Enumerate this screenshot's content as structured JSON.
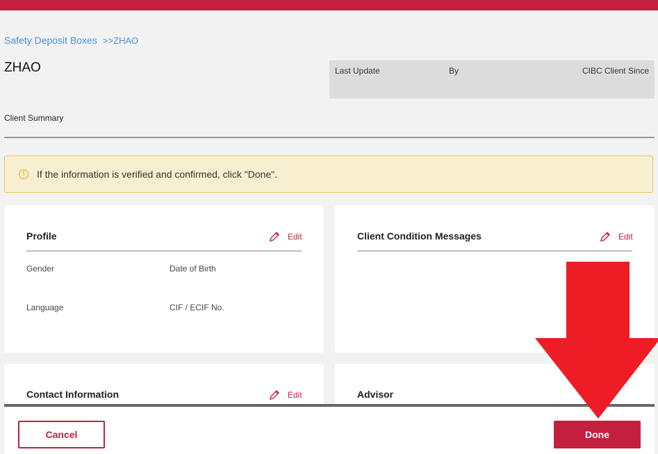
{
  "breadcrumb": {
    "parent": "Safety Deposit Boxes",
    "current": ">>ZHAO"
  },
  "client": {
    "name": "ZHAO"
  },
  "meta": {
    "last_update_label": "Last Update",
    "by_label": "By",
    "client_since_label": "CIBC Client Since"
  },
  "summary": {
    "label": "Client Summary"
  },
  "alert": {
    "icon": "info-circle-icon",
    "text": "If the information is verified and confirmed, click \"Done\"."
  },
  "cards": {
    "profile": {
      "title": "Profile",
      "edit_label": "Edit",
      "fields": [
        "Gender",
        "Date of Birth",
        "Language",
        "CIF / ECIF No."
      ]
    },
    "messages": {
      "title": "Client Condition Messages",
      "edit_label": "Edit"
    },
    "contact": {
      "title": "Contact Information",
      "edit_label": "Edit"
    },
    "advisor": {
      "title": "Advisor"
    }
  },
  "footer": {
    "cancel_label": "Cancel",
    "done_label": "Done"
  },
  "colors": {
    "brand": "#c41f3e",
    "annotation_arrow": "#ee1c25"
  }
}
